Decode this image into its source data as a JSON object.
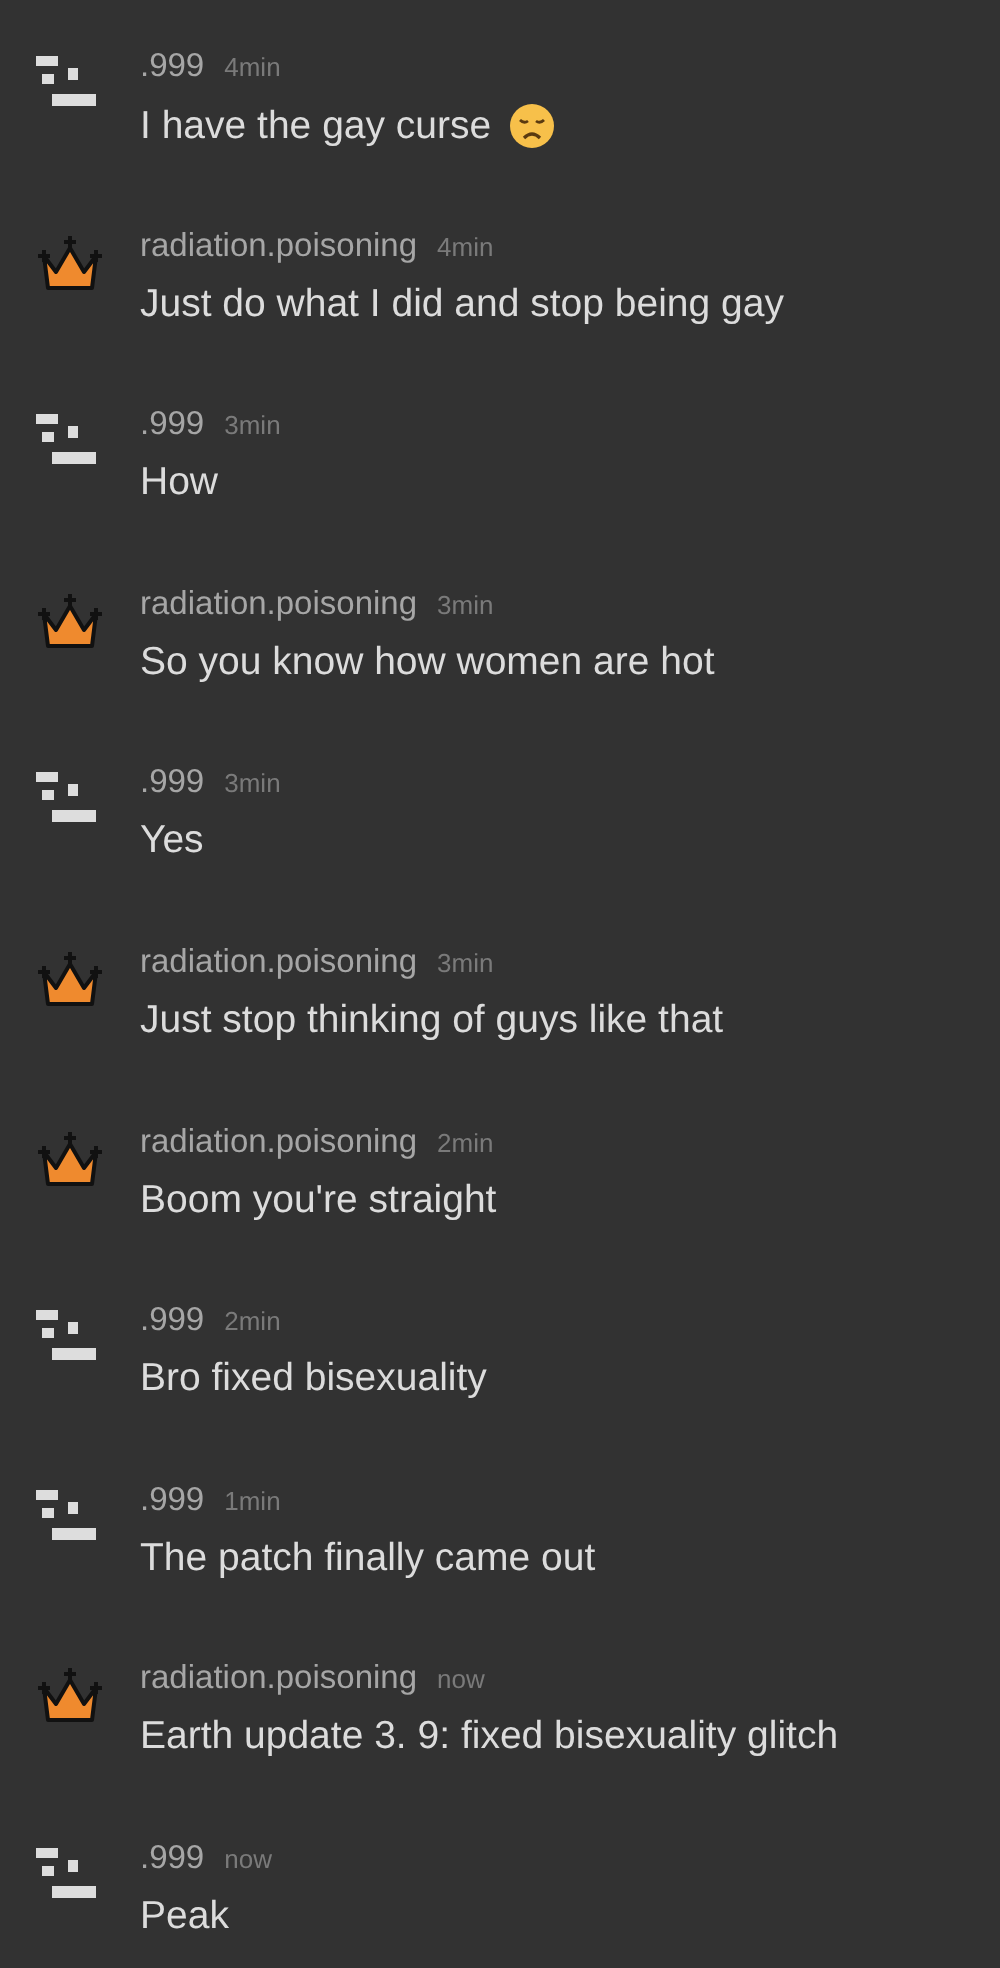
{
  "comments": [
    {
      "kind": "pixel",
      "user": ".999",
      "time": "4min",
      "text": "I have the gay curse",
      "sad_emoji": true
    },
    {
      "kind": "crown",
      "user": "radiation.poisoning",
      "time": "4min",
      "text": "Just do what I did and stop being gay"
    },
    {
      "kind": "pixel",
      "user": ".999",
      "time": "3min",
      "text": "How"
    },
    {
      "kind": "crown",
      "user": "radiation.poisoning",
      "time": "3min",
      "text": "So you know how women are hot"
    },
    {
      "kind": "pixel",
      "user": ".999",
      "time": "3min",
      "text": "Yes"
    },
    {
      "kind": "crown",
      "user": "radiation.poisoning",
      "time": "3min",
      "text": "Just stop thinking of guys like that"
    },
    {
      "kind": "crown",
      "user": "radiation.poisoning",
      "time": "2min",
      "text": "Boom you're straight"
    },
    {
      "kind": "pixel",
      "user": ".999",
      "time": "2min",
      "text": "Bro fixed bisexuality"
    },
    {
      "kind": "pixel",
      "user": ".999",
      "time": "1min",
      "text": "The patch finally came out"
    },
    {
      "kind": "crown",
      "user": "radiation.poisoning",
      "time": "now",
      "text": "Earth update 3. 9: fixed bisexuality glitch"
    },
    {
      "kind": "pixel",
      "user": ".999",
      "time": "now",
      "text": "Peak"
    }
  ]
}
